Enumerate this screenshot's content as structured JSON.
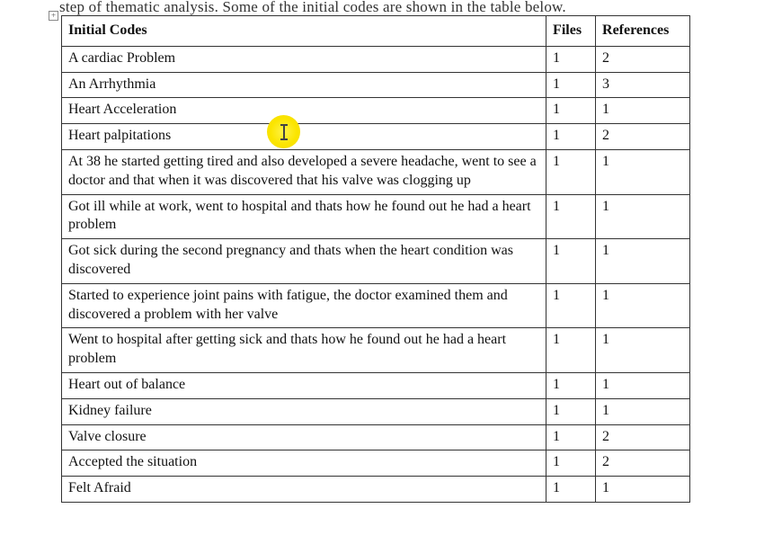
{
  "partial_text": "step of thematic analysis. Some of the initial codes are shown in the table below.",
  "expand_glyph": "+",
  "table": {
    "headers": {
      "codes": "Initial Codes",
      "files": "Files",
      "refs": "References"
    },
    "rows": [
      {
        "code": "A cardiac Problem",
        "files": "1",
        "refs": "2"
      },
      {
        "code": "An Arrhythmia",
        "files": "1",
        "refs": "3"
      },
      {
        "code": "Heart Acceleration",
        "files": "1",
        "refs": "1"
      },
      {
        "code": "Heart palpitations",
        "files": "1",
        "refs": "2"
      },
      {
        "code": "At 38 he started getting tired and also developed a severe headache, went to see a doctor and that when it was discovered that his valve was clogging up",
        "files": "1",
        "refs": "1"
      },
      {
        "code": "Got ill while at work, went to hospital and thats how he found out he had a heart problem",
        "files": "1",
        "refs": "1"
      },
      {
        "code": "Got sick during the second pregnancy and thats when the heart condition was discovered",
        "files": "1",
        "refs": "1"
      },
      {
        "code": "Started to experience joint pains with fatigue, the doctor examined them and discovered a problem with her valve",
        "files": "1",
        "refs": "1"
      },
      {
        "code": "Went to hospital after getting sick and thats how he found out he had a heart problem",
        "files": "1",
        "refs": "1"
      },
      {
        "code": "Heart out of balance",
        "files": "1",
        "refs": "1"
      },
      {
        "code": "Kidney failure",
        "files": "1",
        "refs": "1"
      },
      {
        "code": "Valve closure",
        "files": "1",
        "refs": "2"
      },
      {
        "code": "Accepted the situation",
        "files": "1",
        "refs": "2"
      },
      {
        "code": "Felt Afraid",
        "files": "1",
        "refs": "1"
      }
    ]
  }
}
